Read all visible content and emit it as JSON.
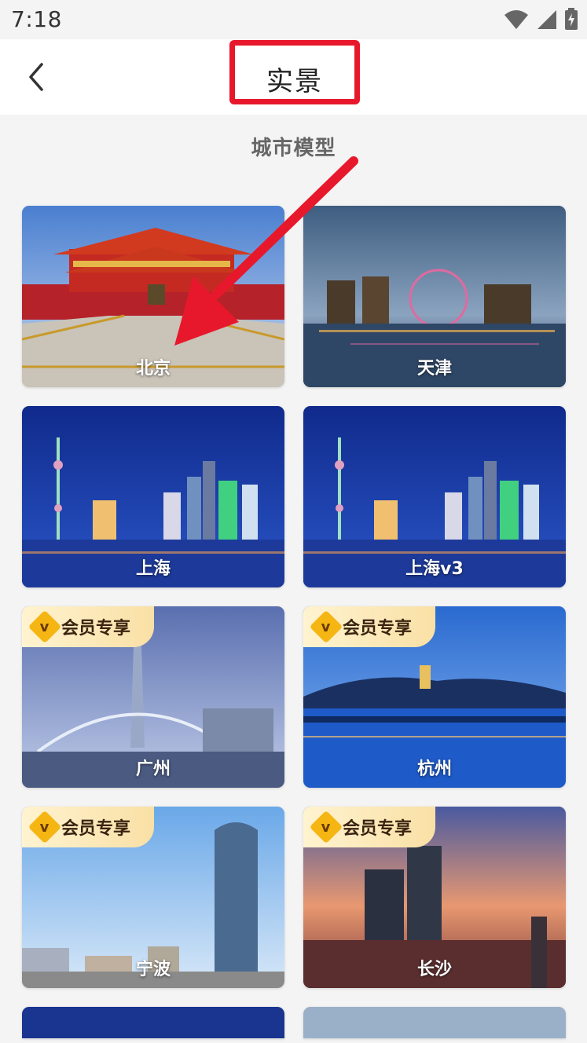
{
  "status_bar": {
    "time": "7:18",
    "icons": [
      "wifi-icon",
      "signal-icon",
      "battery-charging-icon"
    ]
  },
  "header": {
    "back_icon": "chevron-left-icon",
    "title": "实景",
    "highlight_color": "#e8182c"
  },
  "section": {
    "title": "城市模型"
  },
  "cities": [
    {
      "label": "北京",
      "vip": false
    },
    {
      "label": "天津",
      "vip": false
    },
    {
      "label": "上海",
      "vip": false
    },
    {
      "label": "上海v3",
      "vip": false
    },
    {
      "label": "广州",
      "vip": true
    },
    {
      "label": "杭州",
      "vip": true
    },
    {
      "label": "宁波",
      "vip": true
    },
    {
      "label": "长沙",
      "vip": true
    }
  ],
  "vip_badge_text": "会员专享",
  "vip_badge_icon": "v-badge-icon",
  "annotation": {
    "arrow_color": "#e8182c",
    "arrow_icon": "annotation-arrow-icon"
  }
}
